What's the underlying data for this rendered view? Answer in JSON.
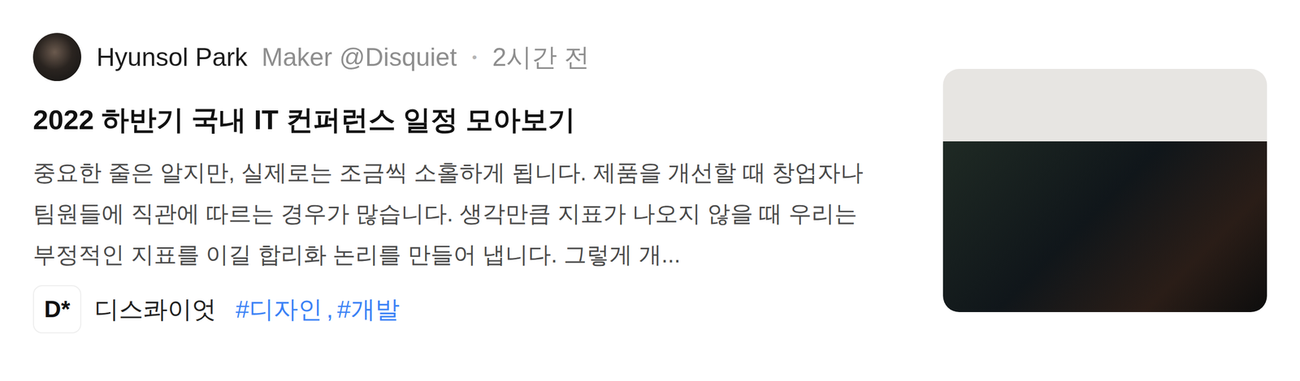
{
  "post": {
    "author": {
      "name": "Hyunsol Park",
      "role": "Maker @Disquiet",
      "separator": "•",
      "time": "2시간 전"
    },
    "title": "2022 하반기 국내 IT 컨퍼런스 일정 모아보기",
    "excerpt": "중요한 줄은 알지만, 실제로는 조금씩 소홀하게 됩니다. 제품을 개선할 때 창업자나 팀원들에 직관에 따르는 경우가 많습니다. 생각만큼 지표가 나오지 않을 때 우리는 부정적인 지표를 이길 합리화 논리를 만들어 냅니다. 그렇게 개...",
    "channel": {
      "logo": "D*",
      "name": "디스콰이엇"
    },
    "tags": [
      "#디자인",
      "#개발"
    ],
    "tag_separator": ","
  }
}
